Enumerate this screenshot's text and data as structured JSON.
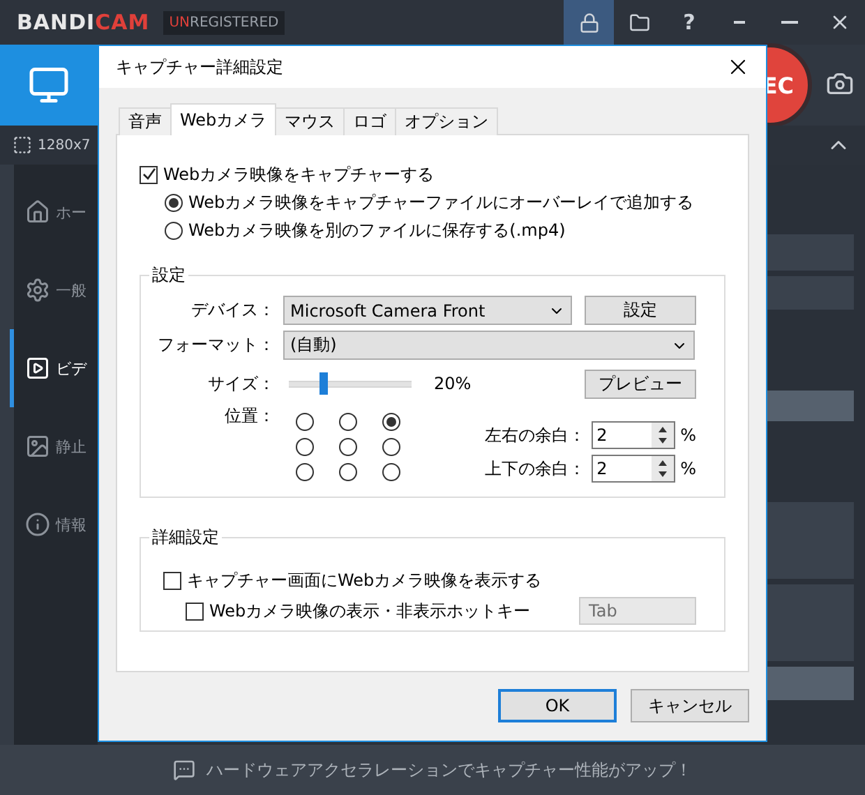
{
  "app": {
    "logo": [
      "BANDI",
      "CAM"
    ],
    "badge": [
      "UN",
      "REGISTERED"
    ],
    "help": "?",
    "capture_size": "1280x7",
    "rec": "EC",
    "sidebar": [
      {
        "kind": "home",
        "label": "ホー",
        "selected": false
      },
      {
        "kind": "gear",
        "label": "一般",
        "selected": false
      },
      {
        "kind": "video",
        "label": "ビデ",
        "selected": true
      },
      {
        "kind": "image",
        "label": "静止",
        "selected": false
      },
      {
        "kind": "info",
        "label": "情報",
        "selected": false
      }
    ],
    "status": "ハードウェアアクセラレーションでキャプチャー性能がアップ！"
  },
  "dialog": {
    "title": "キャプチャー詳細設定",
    "tabs": [
      {
        "label": "音声",
        "selected": false
      },
      {
        "label": "Webカメラ",
        "selected": true
      },
      {
        "label": "マウス",
        "selected": false
      },
      {
        "label": "ロゴ",
        "selected": false
      },
      {
        "label": "オプション",
        "selected": false
      }
    ],
    "enable": {
      "label": "Webカメラ映像をキャプチャーする",
      "checked": true
    },
    "modes": [
      {
        "label": "Webカメラ映像をキャプチャーファイルにオーバーレイで追加する",
        "selected": true
      },
      {
        "label": "Webカメラ映像を別のファイルに保存する(.mp4)",
        "selected": false
      }
    ],
    "settings": {
      "title": "設定",
      "device_label": "デバイス：",
      "device": "Microsoft Camera Front",
      "device_button": "設定",
      "format_label": "フォーマット：",
      "format": "(自動)",
      "size_label": "サイズ：",
      "size": {
        "level": 0.27,
        "reading": "20%"
      },
      "preview_button": "プレビュー",
      "position_label": "位置：",
      "positions": [
        {
          "selected": false
        },
        {
          "selected": false
        },
        {
          "selected": true
        },
        {
          "selected": false
        },
        {
          "selected": false
        },
        {
          "selected": false
        },
        {
          "selected": false
        },
        {
          "selected": false
        },
        {
          "selected": false
        }
      ],
      "margins": [
        {
          "label": "左右の余白：",
          "value": "2",
          "unit": "%"
        },
        {
          "label": "上下の余白：",
          "value": "2",
          "unit": "%"
        }
      ]
    },
    "advanced": {
      "title": "詳細設定",
      "show": {
        "label": "キャプチャー画面にWebカメラ映像を表示する",
        "checked": false
      },
      "hotkey": {
        "label": "Webカメラ映像の表示・非表示ホットキー",
        "checked": false,
        "value": "Tab",
        "disabled": true
      }
    },
    "buttons": [
      {
        "label": "OK",
        "default": true
      },
      {
        "label": "キャンセル",
        "default": false
      }
    ]
  }
}
